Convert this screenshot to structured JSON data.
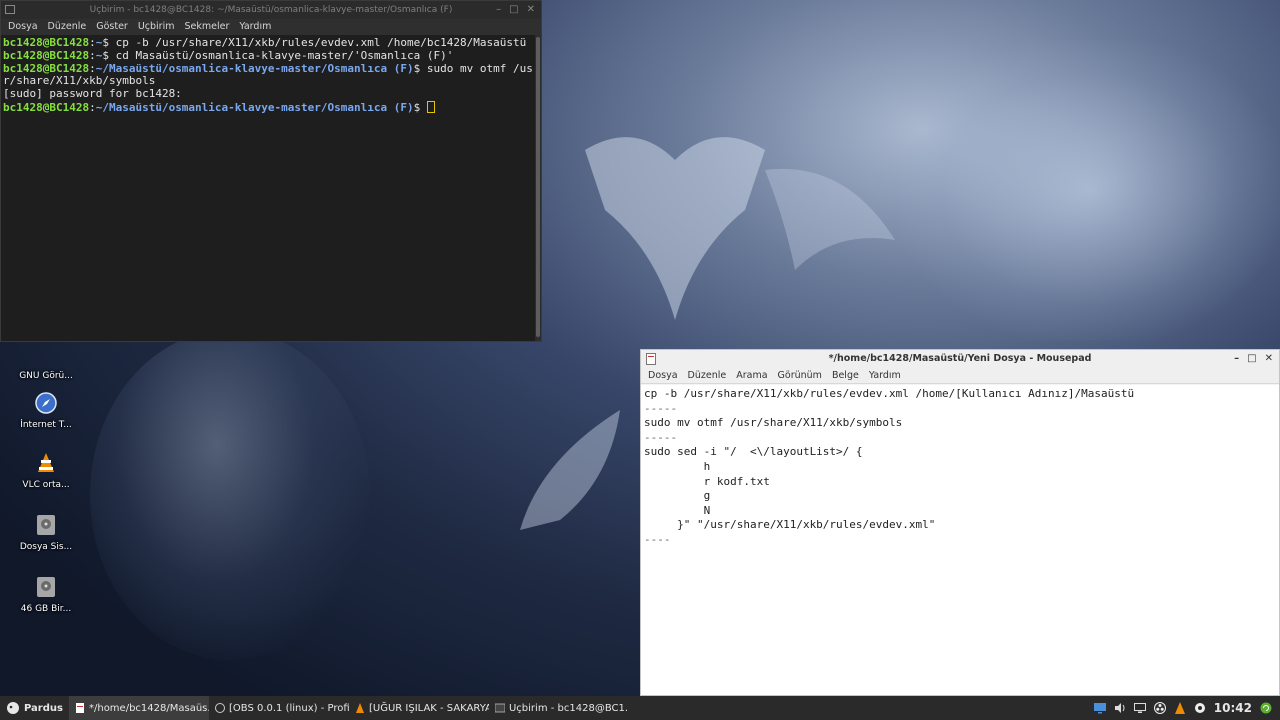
{
  "terminal": {
    "title": "Uçbirim - bc1428@BC1428: ~/Masaüstü/osmanlica-klavye-master/Osmanlıca (F)",
    "menu": [
      "Dosya",
      "Düzenle",
      "Göster",
      "Uçbirim",
      "Sekmeler",
      "Yardım"
    ],
    "lines": [
      {
        "user": "bc1428@BC1428",
        "path": "~",
        "cmd": "$ cp -b /usr/share/X11/xkb/rules/evdev.xml /home/bc1428/Masaüstü"
      },
      {
        "user": "bc1428@BC1428",
        "path": "~",
        "cmd": "$ cd Masaüstü/osmanlica-klavye-master/'Osmanlıca (F)'"
      },
      {
        "user": "bc1428@BC1428",
        "path": "~/Masaüstü/osmanlica-klavye-master/Osmanlıca (F)",
        "cmd": "$ sudo mv otmf /us"
      },
      {
        "text": "r/share/X11/xkb/symbols"
      },
      {
        "text": "[sudo] password for bc1428:"
      },
      {
        "user": "bc1428@BC1428",
        "path": "~/Masaüstü/osmanlica-klavye-master/Osmanlıca (F)",
        "cmd": "$ "
      }
    ]
  },
  "desktop_icons": [
    {
      "label": "GNU Görü..."
    },
    {
      "label": "İnternet T..."
    },
    {
      "label": "VLC orta..."
    },
    {
      "label": "Dosya Sis..."
    },
    {
      "label": "46 GB Bir..."
    }
  ],
  "mousepad": {
    "title": "*/home/bc1428/Masaüstü/Yeni Dosya - Mousepad",
    "menu": [
      "Dosya",
      "Düzenle",
      "Arama",
      "Görünüm",
      "Belge",
      "Yardım"
    ],
    "lines": [
      "cp -b /usr/share/X11/xkb/rules/evdev.xml /home/[Kullanıcı Adınız]/Masaüstü",
      "-----",
      "sudo mv otmf /usr/share/X11/xkb/symbols",
      "-----",
      "sudo sed -i \"/  <\\/layoutList>/ {",
      "         h",
      "         r kodf.txt",
      "         g",
      "         N",
      "     }\" \"/usr/share/X11/xkb/rules/evdev.xml\"",
      "----"
    ]
  },
  "taskbar": {
    "start_label": "Pardus",
    "tasks": [
      {
        "label": "*/home/bc1428/Masaüs...",
        "icon": "mousepad-icon",
        "active": true
      },
      {
        "label": "[OBS 0.0.1 (linux) - Profi...",
        "icon": "obs-icon",
        "active": false
      },
      {
        "label": "[UĞUR IŞILAK - SAKARYA...",
        "icon": "vlc-icon",
        "active": false
      },
      {
        "label": "Uçbirim - bc1428@BC1...",
        "icon": "terminal-icon",
        "active": false
      }
    ],
    "clock": "10:42"
  }
}
